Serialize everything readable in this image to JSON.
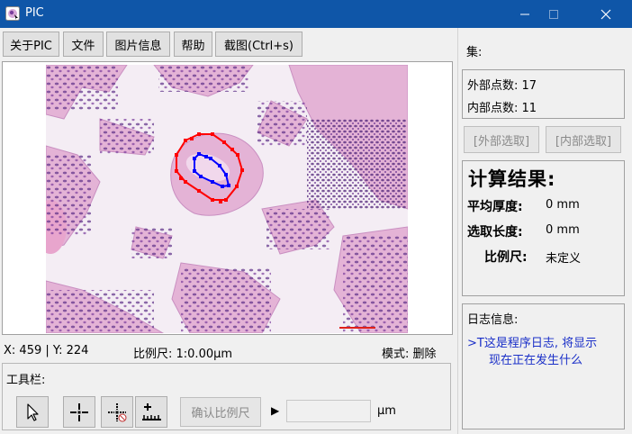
{
  "window": {
    "title": "PIC"
  },
  "menu": {
    "about": "关于PIC",
    "file": "文件",
    "image_info": "图片信息",
    "help": "帮助",
    "screenshot": "截图(Ctrl+s)"
  },
  "status": {
    "coords": "X: 459 | Y: 224",
    "scale": "比例尺: 1:0.00μm",
    "mode": "模式:  删除"
  },
  "toolbar": {
    "label": "工具栏:",
    "confirm_scale": "确认比例尺",
    "play_marker": "▶",
    "scale_value": "",
    "unit": "μm"
  },
  "sidebar": {
    "set_label": "集:",
    "outer_points": "外部点数: 17",
    "inner_points": "内部点数: 11",
    "outer_select": "[外部选取]",
    "inner_select": "[内部选取]",
    "result_title": "计算结果:",
    "avg_thickness_label": "平均厚度:",
    "avg_thickness_value": "0 mm",
    "select_length_label": "选取长度:",
    "select_length_value": "0 mm",
    "scale_label": "比例尺:",
    "scale_value": "未定义",
    "log_title": "日志信息:",
    "log_line1": ">T这是程序日志, 将显示",
    "log_line2": "现在正在发生什么"
  },
  "colors": {
    "titlebar": "#0f56a8",
    "outer_contour": "#ff0000",
    "inner_contour": "#0000ff",
    "log_text": "#1a2fc8",
    "tissue_pink": "#e7b6d6",
    "nuclei_purple": "#5b2d86"
  },
  "icons": {
    "app": "pic-app-icon",
    "minimize": "minimize-icon",
    "maximize": "maximize-icon",
    "close": "close-icon",
    "select_tool": "cursor-arrow-icon",
    "add_point_tool": "crosshair-add-icon",
    "delete_point_tool": "crosshair-delete-icon",
    "ruler_tool": "ruler-scale-icon"
  }
}
